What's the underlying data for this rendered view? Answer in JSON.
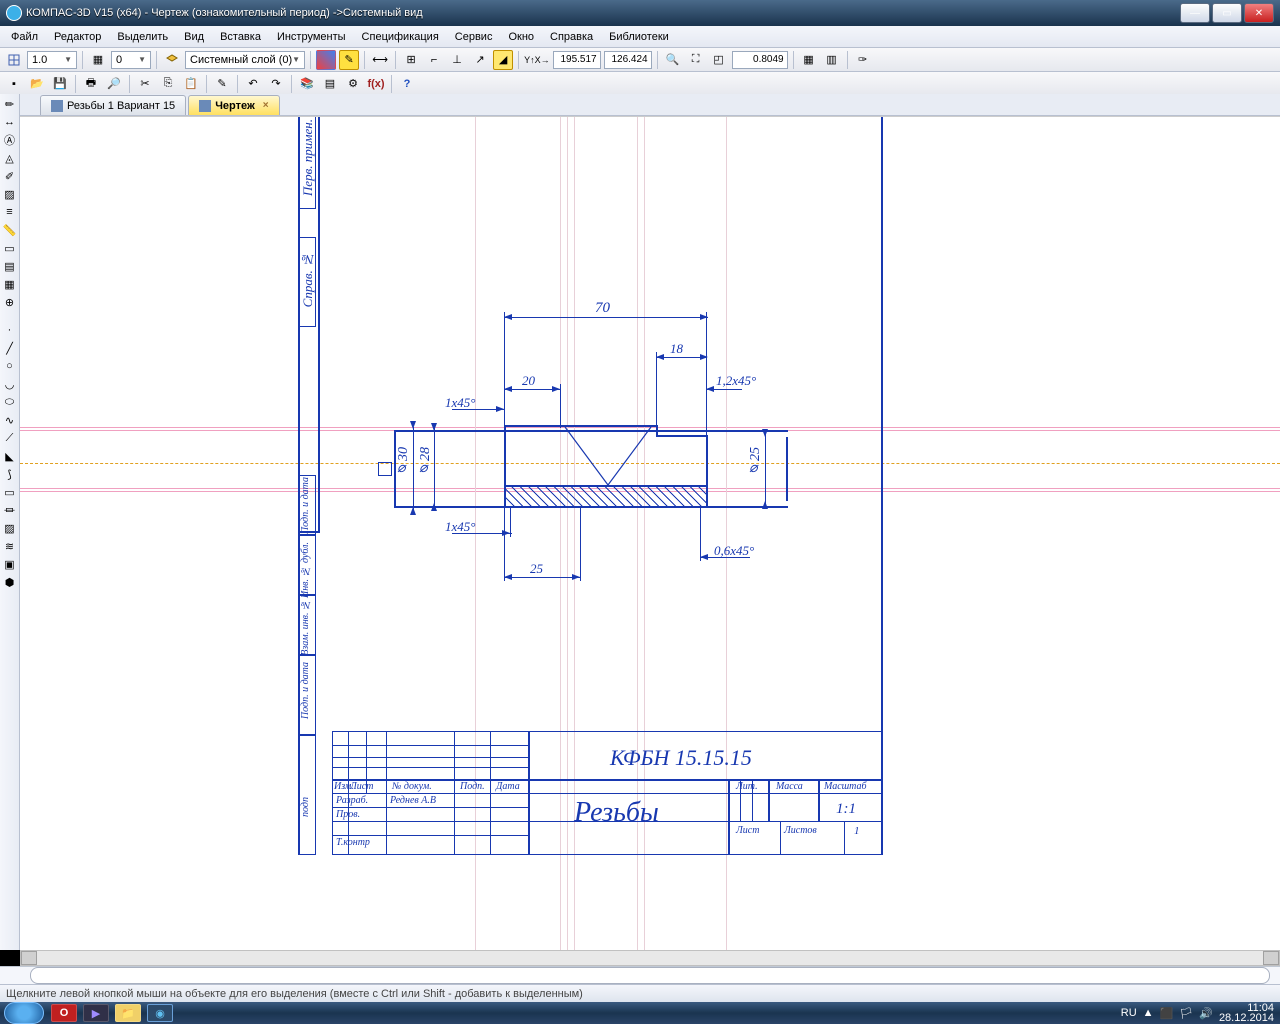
{
  "window": {
    "title": "КОМПАС-3D V15 (x64) - Чертеж (ознакомительный период) ->Системный вид"
  },
  "menu": {
    "items": [
      "Файл",
      "Редактор",
      "Выделить",
      "Вид",
      "Вставка",
      "Инструменты",
      "Спецификация",
      "Сервис",
      "Окно",
      "Справка",
      "Библиотеки"
    ]
  },
  "toolbar1": {
    "scale": "1.0",
    "step": "0",
    "layer": "Системный слой (0)",
    "coordX": "195.517",
    "coordY": "126.424",
    "zoom": "0.8049"
  },
  "tabs": {
    "items": [
      {
        "label": "Резьбы 1 Вариант 15",
        "active": false
      },
      {
        "label": "Чертеж",
        "active": true
      }
    ]
  },
  "drawing": {
    "dims": {
      "d70": "70",
      "d18": "18",
      "d20": "20",
      "c1": "1,2x45°",
      "c2": "1x45°",
      "c3": "1x45°",
      "c4": "0,6x45°",
      "d25": "25",
      "dia30": "⌀30",
      "dia28": "⌀28",
      "dia25": "⌀25"
    },
    "titleblock": {
      "code": "КФБН 15.15.15",
      "name": "Резьбы",
      "row_labels": {
        "izm": "Изм.",
        "list": "Лист",
        "ndoc": "№ докум.",
        "podp": "Подп.",
        "data": "Дата",
        "razrab": "Разраб.",
        "prov": "Пров.",
        "tkontr": "Т.контр"
      },
      "razrab_name": "Реднев А.В",
      "headers": {
        "lit": "Лит.",
        "massa": "Масса",
        "masshtab": "Масштаб",
        "list2": "Лист",
        "listov": "Листов"
      },
      "scale": "1:1",
      "sheets": "1"
    },
    "stamps": {
      "s1": "Перв. примен.",
      "s2": "Справ. №",
      "s3": "Подп. и дата",
      "s4": "Взам. инв. №",
      "s5": "Инв. № дубл.",
      "s6": "Подп. и дата",
      "s7": "подп"
    }
  },
  "status": {
    "text": "Щелкните левой кнопкой мыши на объекте для его выделения (вместе с Ctrl или Shift - добавить к выделенным)"
  },
  "tray": {
    "lang": "RU",
    "time": "11:04",
    "date": "28.12.2014"
  }
}
